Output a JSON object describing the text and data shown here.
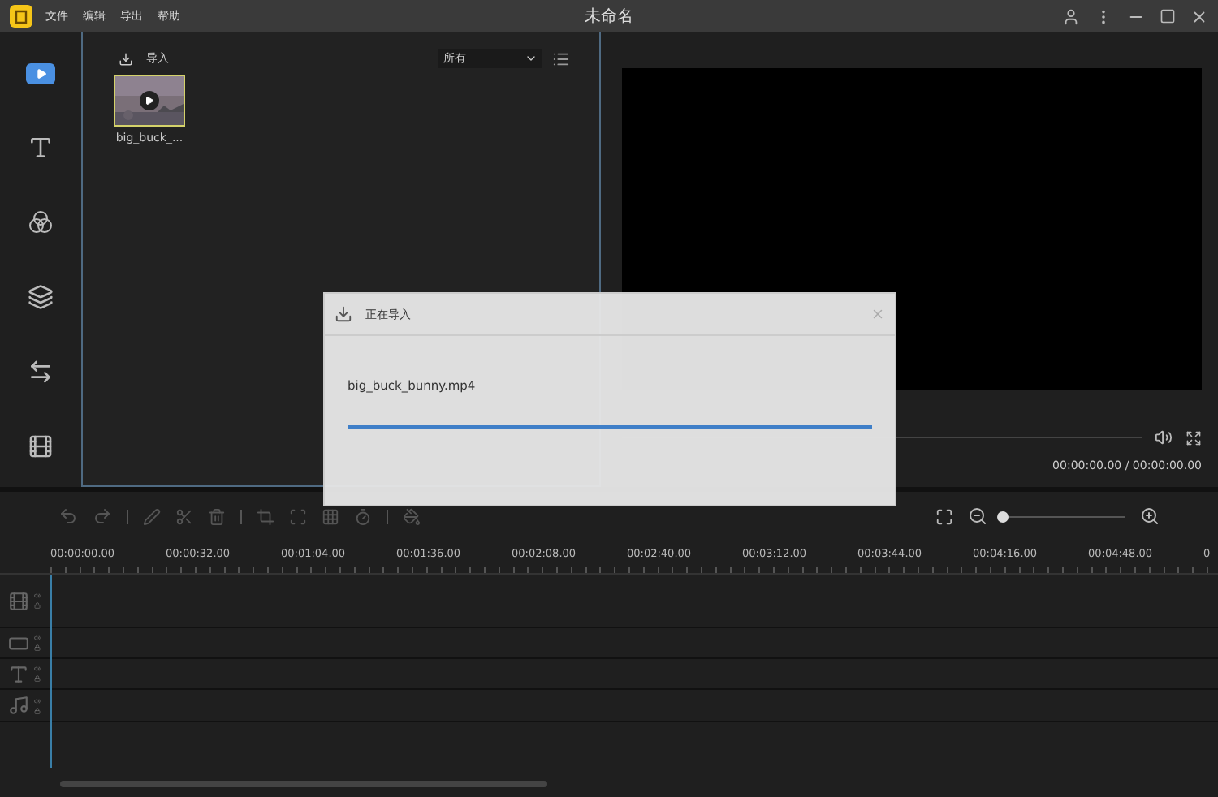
{
  "window": {
    "title": "未命名",
    "menu": [
      "文件",
      "编辑",
      "导出",
      "帮助"
    ]
  },
  "sidebar": {
    "items": [
      {
        "kind": "media",
        "selected": true
      },
      {
        "kind": "text",
        "selected": false
      },
      {
        "kind": "filter",
        "selected": false
      },
      {
        "kind": "overlay",
        "selected": false
      },
      {
        "kind": "transition",
        "selected": false
      },
      {
        "kind": "element",
        "selected": false
      }
    ]
  },
  "media_panel": {
    "import_label": "导入",
    "filter": "所有",
    "items": [
      {
        "name": "big_buck_...",
        "selected": true
      }
    ]
  },
  "player": {
    "time": "00:00:00.00 / 00:00:00.00"
  },
  "timeline": {
    "zoom": {
      "level": 0
    },
    "ruler": [
      "00:00:00.00",
      "00:00:32.00",
      "00:01:04.00",
      "00:01:36.00",
      "00:02:08.00",
      "00:02:40.00",
      "00:03:12.00",
      "00:03:44.00",
      "00:04:16.00",
      "00:04:48.00",
      "0"
    ],
    "tracks": [
      {
        "kind": "video"
      },
      {
        "kind": "overlay"
      },
      {
        "kind": "text"
      },
      {
        "kind": "audio"
      }
    ]
  },
  "dialog": {
    "title": "正在导入",
    "file": "big_buck_bunny.mp4",
    "level": 1
  }
}
